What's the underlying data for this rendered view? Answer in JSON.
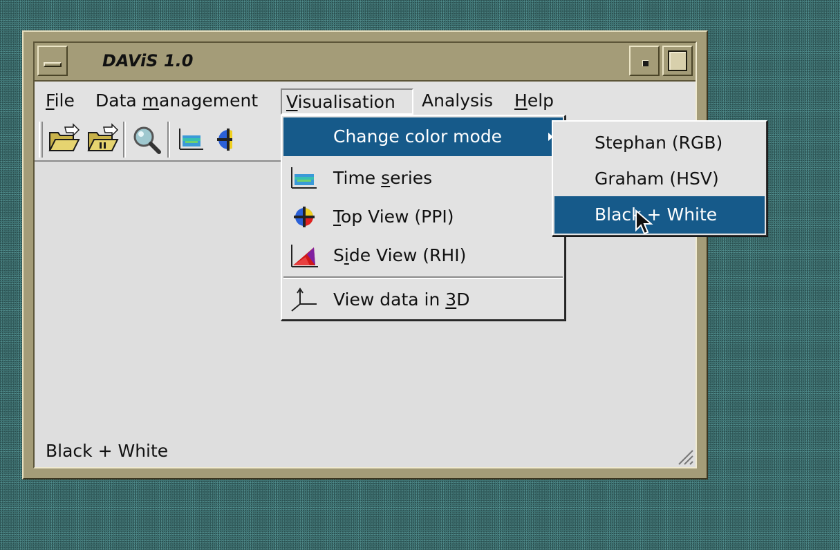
{
  "window": {
    "title": "DAViS 1.0"
  },
  "menubar": {
    "items": [
      {
        "pre": "",
        "u": "F",
        "post": "ile"
      },
      {
        "pre": "Data ",
        "u": "m",
        "post": "anagement"
      },
      {
        "pre": "",
        "u": "V",
        "post": "isualisation"
      },
      {
        "pre": "Analysis",
        "u": "",
        "post": ""
      },
      {
        "pre": "",
        "u": "H",
        "post": "elp"
      }
    ]
  },
  "toolbar": {
    "tools": [
      "open-folder-icon",
      "open-folder-alt-icon",
      "magnifier-icon",
      "time-series-icon",
      "top-view-icon"
    ]
  },
  "visualisation_menu": {
    "items": [
      {
        "pre": "Change color mode",
        "u": "",
        "post": "",
        "icon": "",
        "has_submenu": true,
        "highlighted": true
      },
      {
        "pre": "Time ",
        "u": "s",
        "post": "eries",
        "icon": "time-series-icon"
      },
      {
        "pre": "",
        "u": "T",
        "post": "op View (PPI)",
        "icon": "top-view-icon"
      },
      {
        "pre": "S",
        "u": "i",
        "post": "de View (RHI)",
        "icon": "side-view-icon"
      },
      {
        "pre": "View data in ",
        "u": "3",
        "post": "D",
        "icon": "axes-3d-icon"
      }
    ]
  },
  "color_mode_submenu": {
    "items": [
      {
        "label": "Stephan (RGB)",
        "highlighted": false
      },
      {
        "label": "Graham (HSV)",
        "highlighted": false
      },
      {
        "label": "Black + White",
        "highlighted": true
      }
    ]
  },
  "statusbar": {
    "text": "Black + White"
  },
  "colors": {
    "highlight": "#165a8a",
    "frame": "#a49c78",
    "desktop": "#3f7474"
  }
}
